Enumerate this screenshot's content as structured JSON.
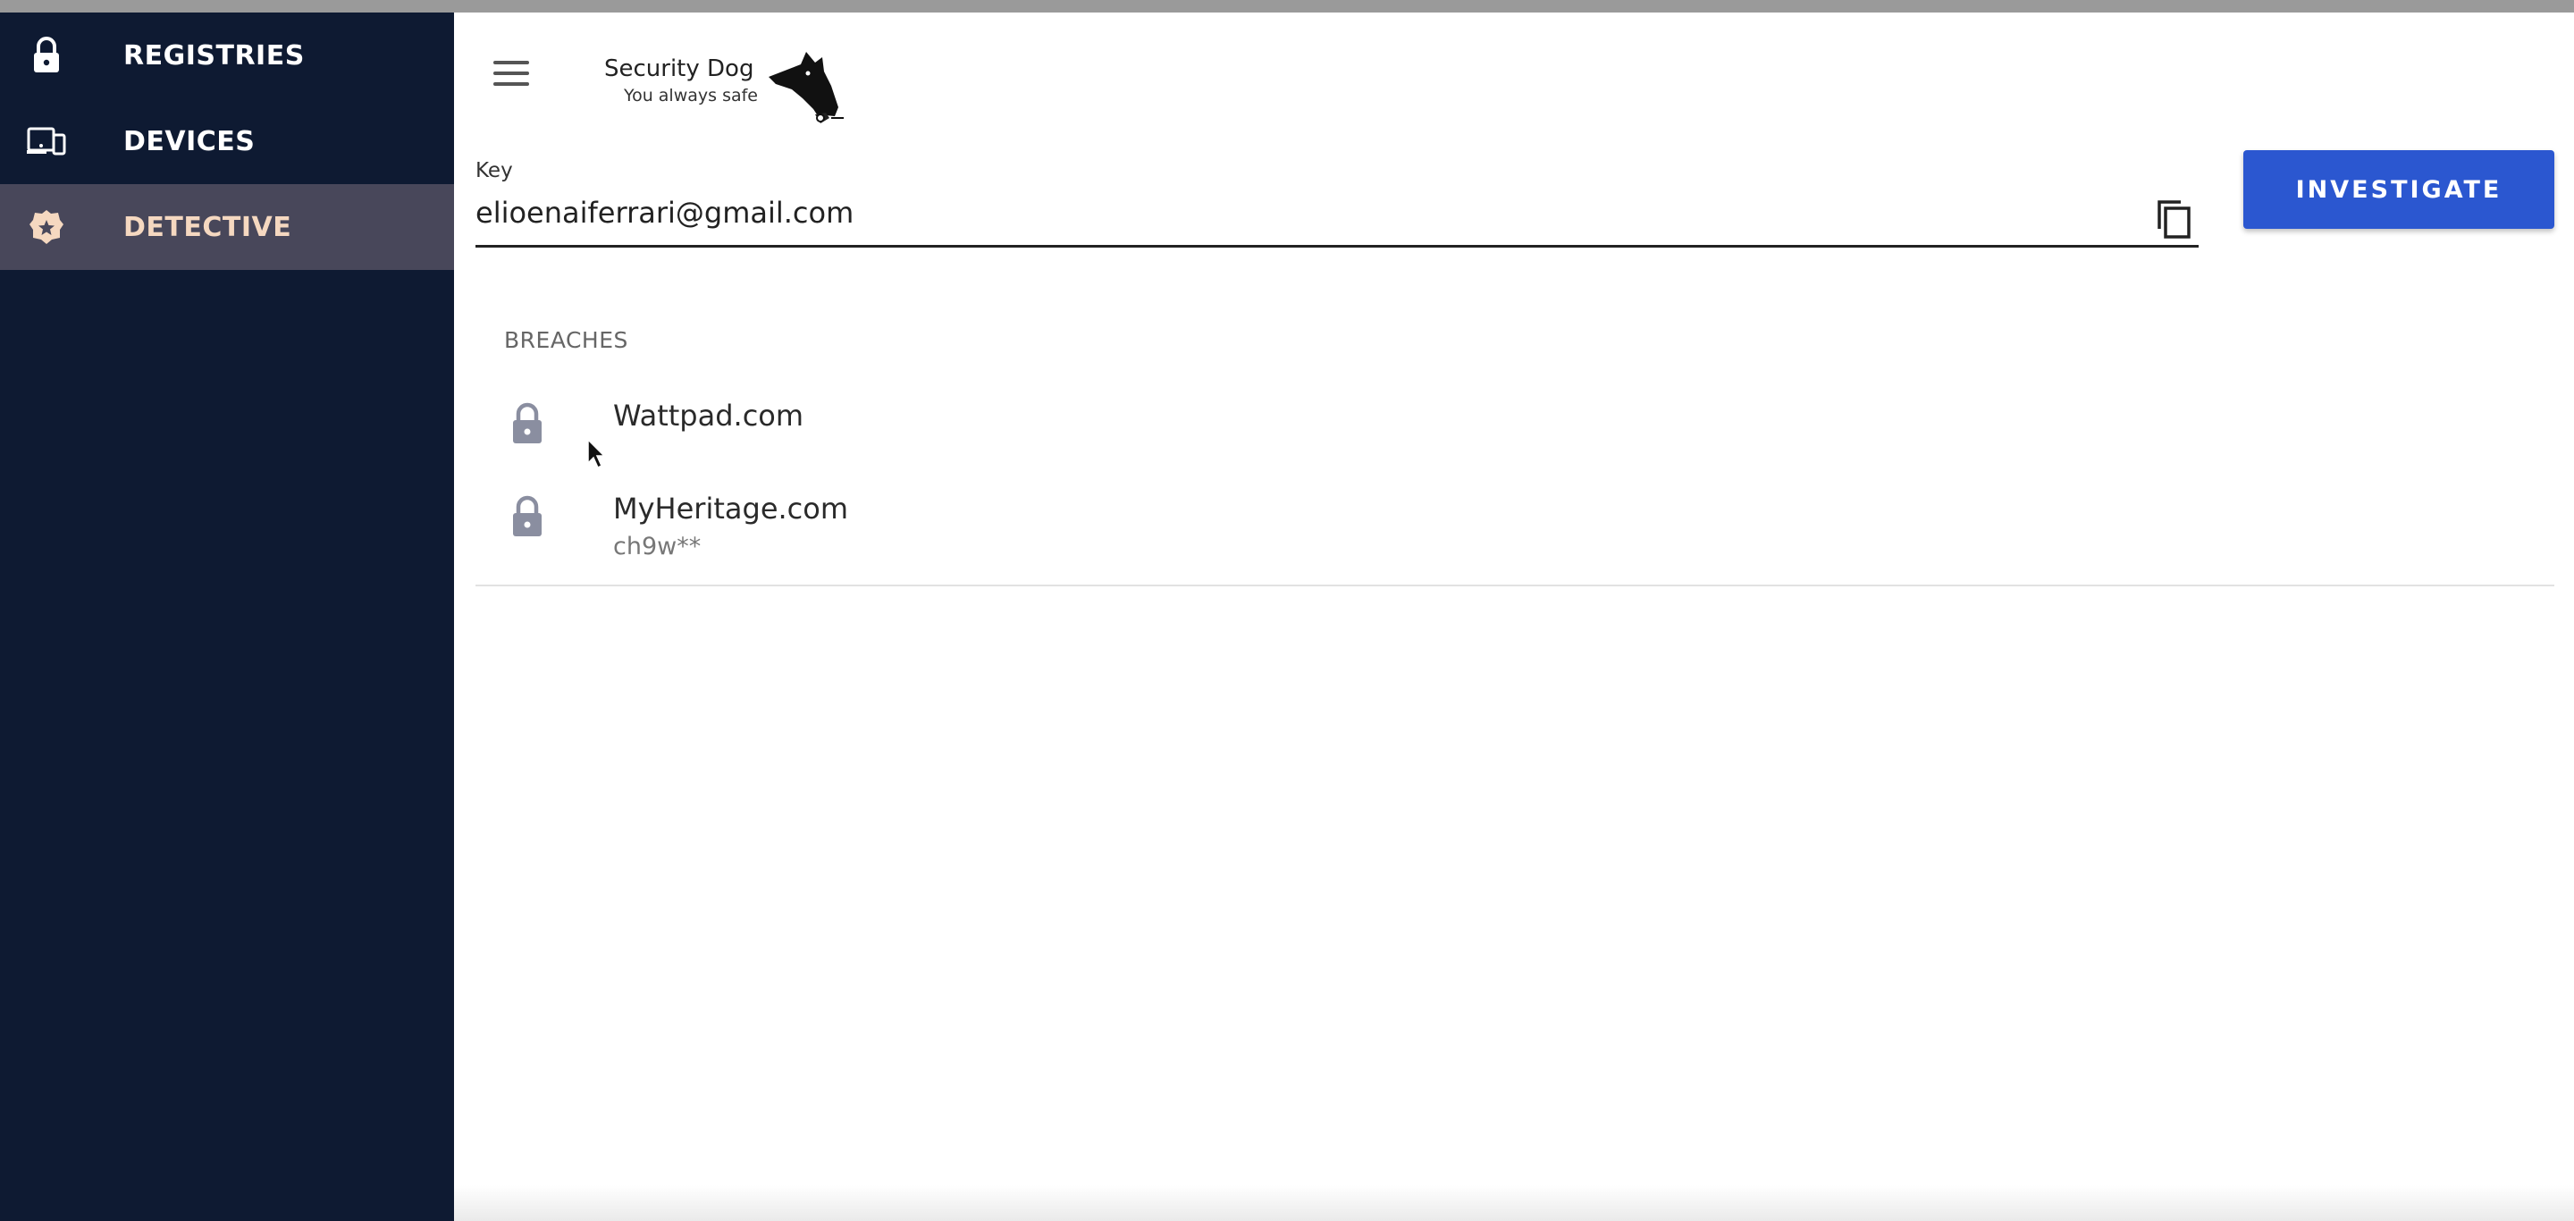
{
  "sidebar": {
    "items": [
      {
        "label": "REGISTRIES",
        "icon": "lock-icon",
        "active": false
      },
      {
        "label": "DEVICES",
        "icon": "devices-icon",
        "active": false
      },
      {
        "label": "DETECTIVE",
        "icon": "badge-icon",
        "active": true
      }
    ]
  },
  "header": {
    "logo_title": "Security Dog",
    "logo_subtitle": "You always safe"
  },
  "search": {
    "label": "Key",
    "value": "elioenaiferrari@gmail.com",
    "button_label": "INVESTIGATE"
  },
  "breaches": {
    "title": "BREACHES",
    "items": [
      {
        "name": "Wattpad.com",
        "detail": ""
      },
      {
        "name": "MyHeritage.com",
        "detail": "ch9w**"
      }
    ]
  },
  "colors": {
    "sidebar_bg": "#0e1a32",
    "active_item_bg": "#48475a",
    "active_item_text": "#f5d8c0",
    "primary_button": "#2b57d0",
    "lock_icon": "#8a8ea0"
  }
}
